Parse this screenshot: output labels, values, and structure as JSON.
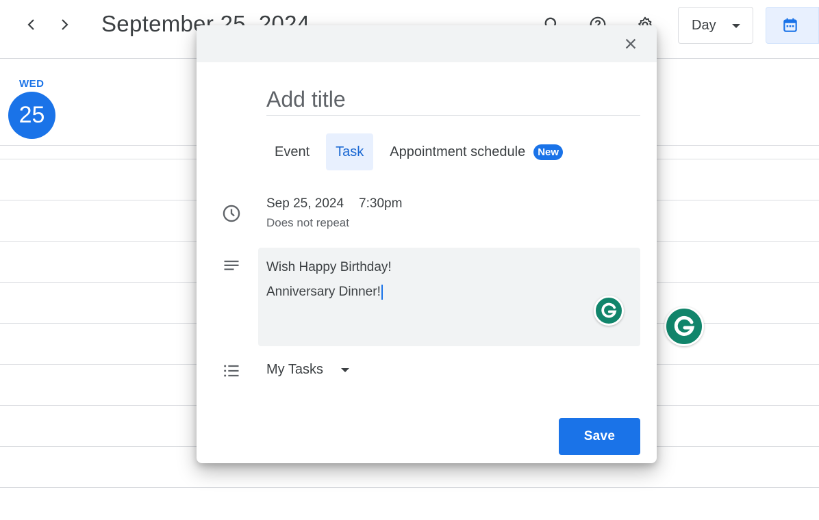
{
  "calendar": {
    "title": "September 25, 2024",
    "view": "Day",
    "day_of_week": "WED",
    "day_number": "25"
  },
  "dialog": {
    "title_placeholder": "Add title",
    "tabs": [
      {
        "label": "Event"
      },
      {
        "label": "Task",
        "active": true
      },
      {
        "label": "Appointment schedule",
        "badge": "New"
      }
    ],
    "date": "Sep 25, 2024",
    "time": "7:30pm",
    "repeat": "Does not repeat",
    "description_lines": [
      "Wish Happy Birthday!",
      "Anniversary Dinner!"
    ],
    "task_list": "My Tasks",
    "save_label": "Save"
  },
  "colors": {
    "accent": "#1a73e8",
    "grammarly": "#11856b"
  }
}
